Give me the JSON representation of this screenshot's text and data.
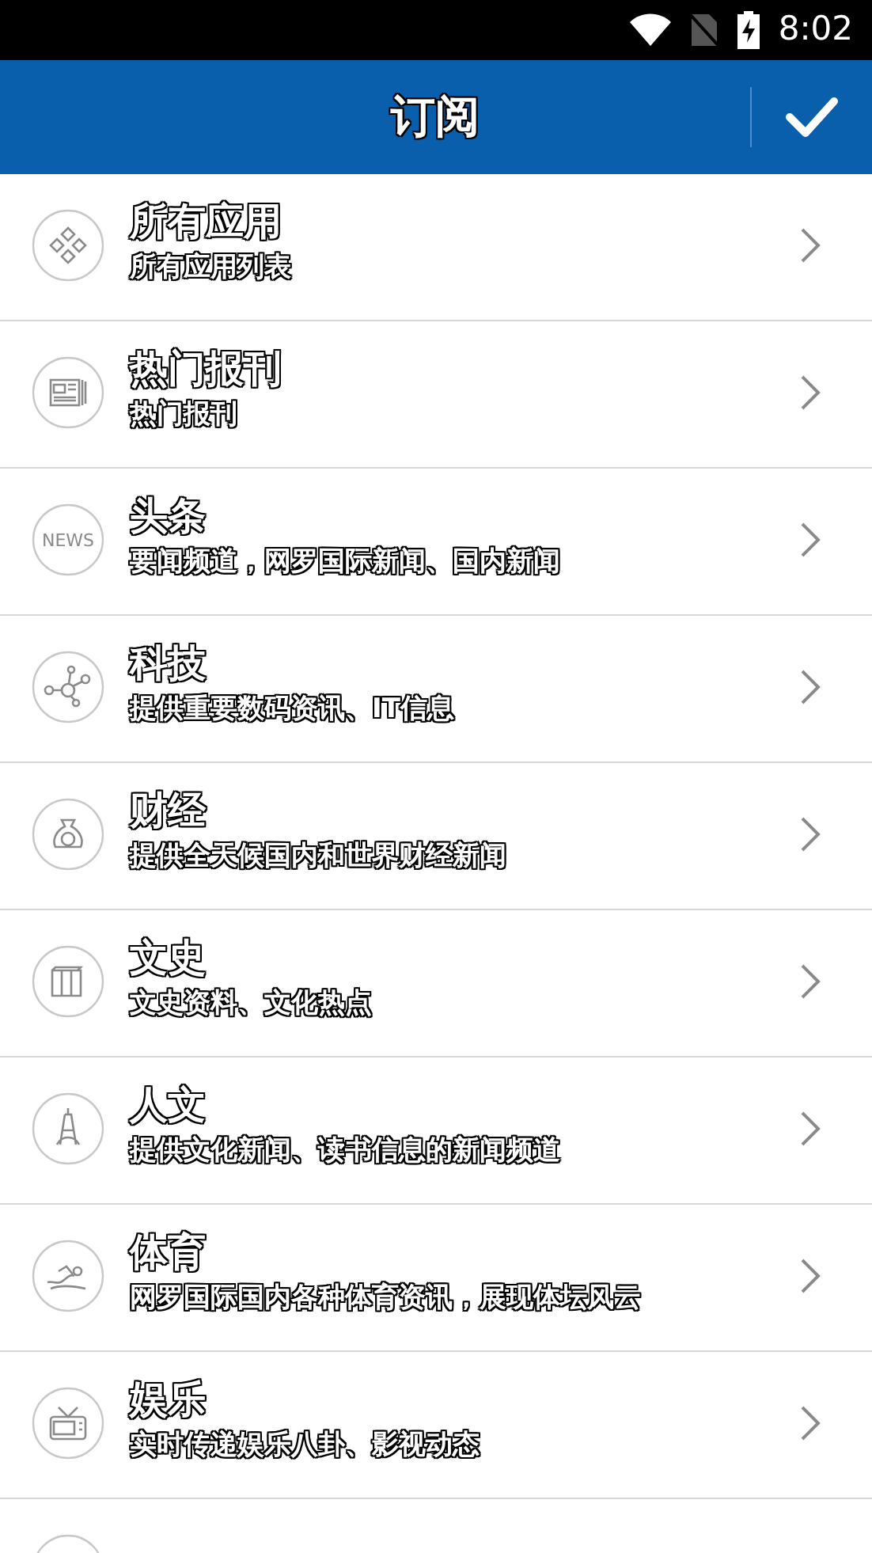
{
  "status_bar": {
    "time": "8:02"
  },
  "header": {
    "title": "订阅"
  },
  "items": [
    {
      "kind": "apps",
      "title": "所有应用",
      "subtitle": "所有应用列表"
    },
    {
      "kind": "newspaper",
      "title": "热门报刊",
      "subtitle": "热门报刊"
    },
    {
      "kind": "news",
      "icon_text": "NEWS",
      "title": "头条",
      "subtitle": "要闻频道，网罗国际新闻、国内新闻"
    },
    {
      "kind": "network",
      "title": "科技",
      "subtitle": "提供重要数码资讯、IT信息"
    },
    {
      "kind": "money",
      "title": "财经",
      "subtitle": "提供全天候国内和世界财经新闻"
    },
    {
      "kind": "books",
      "title": "文史",
      "subtitle": "文史资料、文化热点"
    },
    {
      "kind": "tower",
      "title": "人文",
      "subtitle": "提供文化新闻、读书信息的新闻频道"
    },
    {
      "kind": "swimmer",
      "title": "体育",
      "subtitle": "网罗国际国内各种体育资讯，展现体坛风云"
    },
    {
      "kind": "tv",
      "title": "娱乐",
      "subtitle": "实时传递娱乐八卦、影视动态"
    },
    {
      "kind": "blank"
    }
  ]
}
